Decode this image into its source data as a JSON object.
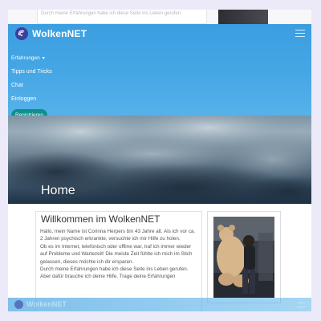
{
  "ghost": {
    "top_text": "Durch meine Erfahrungen habe ich diese Seite ins Leben gerufen."
  },
  "navbar": {
    "brand": "WolkenNET",
    "items": [
      {
        "label": "Erfahrungen"
      },
      {
        "label": "Tipps und Tricks"
      },
      {
        "label": "Chat"
      },
      {
        "label": "Einloggen"
      }
    ],
    "register_label": "Registrieren"
  },
  "hero": {
    "title": "Home"
  },
  "welcome": {
    "title": "Willkommen im WolkenNET",
    "paragraphs": [
      "Hallo, mein Name ist Corinna Herpers bin 43 Jahre alt. Als ich vor ca. 2 Jahren psychisch erkrankte, versuchte ich mir Hilfe zu holen.",
      "Ob es im Internet, telefonisch oder offline war, traf ich immer wieder auf Probleme und Wartezeit! Die meiste Zeit fühlte ich mich im Stich gelassen, dieses möchte ich dir ersparen.",
      "Durch meine Erfahrungen habe ich diese Seite ins Leben gerufen.",
      "Aber dafür brauche ich deine Hilfe. Trage deine Erfahrungen"
    ]
  },
  "footer_ghost": {
    "brand": "WolkenNET"
  },
  "colors": {
    "navbar_top": "#3a9ee0",
    "navbar_bottom": "#5bb4ea",
    "register_button": "#0f8f8e",
    "brand_logo": "#3d3f9e"
  }
}
